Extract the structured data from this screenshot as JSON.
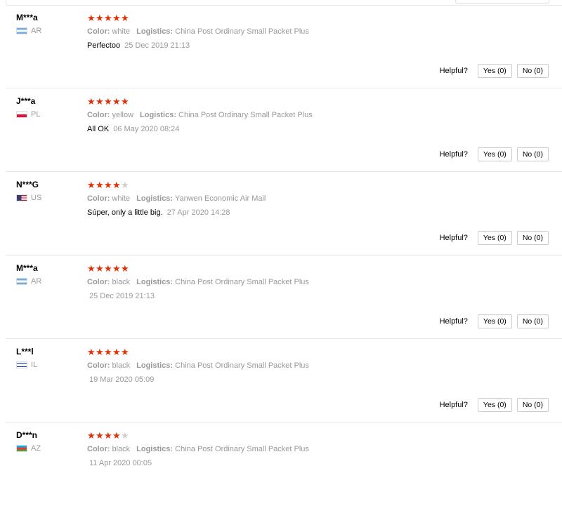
{
  "helpful_label": "Helpful?",
  "reviews": [
    {
      "user": "M***a",
      "country": "AR",
      "stars": 5,
      "color_label": "Color:",
      "color": "white",
      "logistics_label": "Logistics:",
      "logistics": "China Post Ordinary Small Packet Plus",
      "text": "Perfectoo",
      "date": "25 Dec 2019 21:13",
      "yes": "Yes (0)",
      "no": "No (0)"
    },
    {
      "user": "J***a",
      "country": "PL",
      "stars": 5,
      "color_label": "Color:",
      "color": "yellow",
      "logistics_label": "Logistics:",
      "logistics": "China Post Ordinary Small Packet Plus",
      "text": "All OK",
      "date": "06 May 2020 08:24",
      "yes": "Yes (0)",
      "no": "No (0)"
    },
    {
      "user": "N***G",
      "country": "US",
      "stars": 4,
      "color_label": "Color:",
      "color": "white",
      "logistics_label": "Logistics:",
      "logistics": "Yanwen Economic Air Mail",
      "text": "Súper, only a little big.",
      "date": "27 Apr 2020 14:28",
      "yes": "Yes (0)",
      "no": "No (0)"
    },
    {
      "user": "M***a",
      "country": "AR",
      "stars": 5,
      "color_label": "Color:",
      "color": "black",
      "logistics_label": "Logistics:",
      "logistics": "China Post Ordinary Small Packet Plus",
      "text": "",
      "date": "25 Dec 2019 21:13",
      "yes": "Yes (0)",
      "no": "No (0)"
    },
    {
      "user": "L***l",
      "country": "IL",
      "stars": 5,
      "color_label": "Color:",
      "color": "black",
      "logistics_label": "Logistics:",
      "logistics": "China Post Ordinary Small Packet Plus",
      "text": "",
      "date": "19 Mar 2020 05:09",
      "yes": "Yes (0)",
      "no": "No (0)"
    },
    {
      "user": "D***n",
      "country": "AZ",
      "stars": 4,
      "color_label": "Color:",
      "color": "black",
      "logistics_label": "Logistics:",
      "logistics": "China Post Ordinary Small Packet Plus",
      "text": "",
      "date": "11 Apr 2020 00:05",
      "yes": "Yes (0)",
      "no": "No (0)"
    }
  ],
  "star_colors": {
    "on": "#e62e04",
    "off": "#cfcfcf"
  }
}
